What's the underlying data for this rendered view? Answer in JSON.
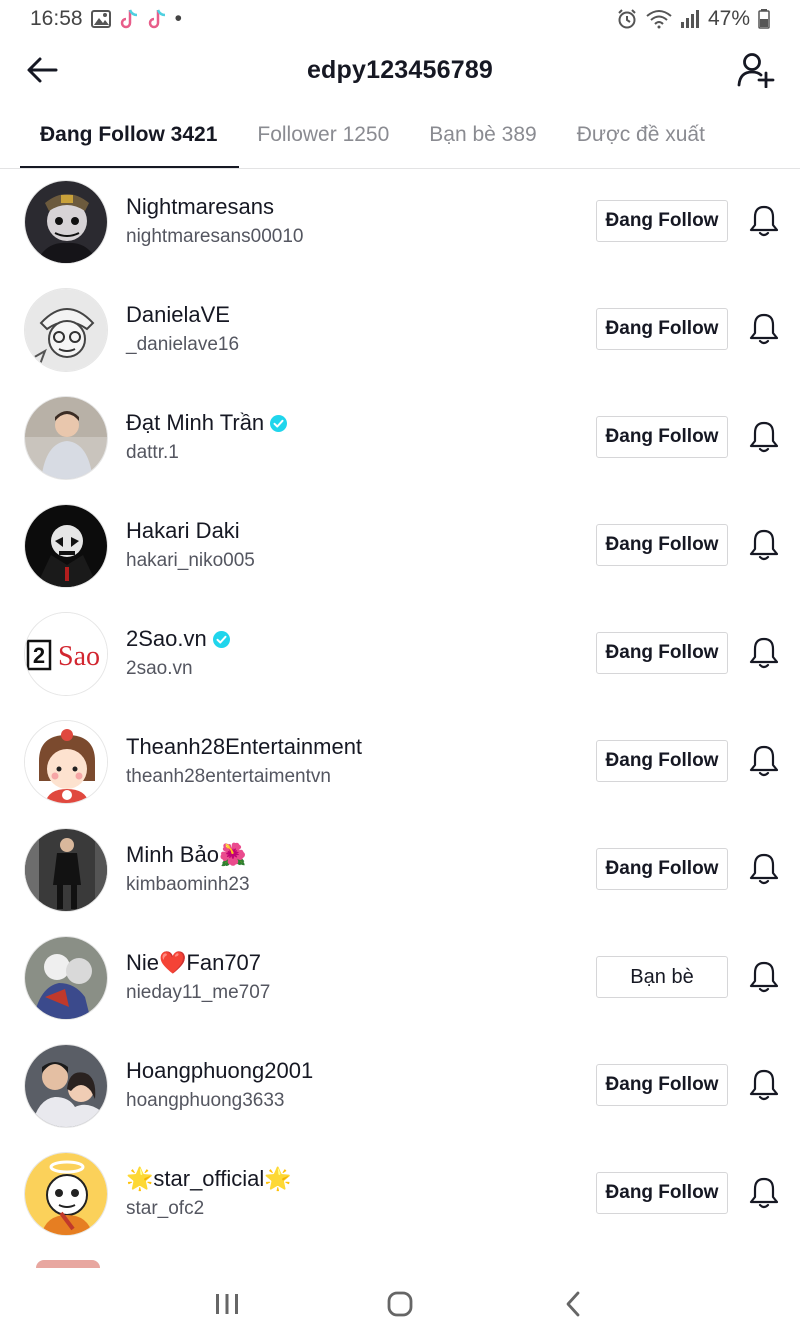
{
  "status_bar": {
    "time": "16:58",
    "dot": "•",
    "battery": "47%"
  },
  "header": {
    "title": "edpy123456789"
  },
  "tabs": [
    {
      "label": "Đang Follow 3421",
      "active": true
    },
    {
      "label": "Follower 1250",
      "active": false
    },
    {
      "label": "Bạn bè 389",
      "active": false
    },
    {
      "label": "Được đề xuất",
      "active": false
    }
  ],
  "users": [
    {
      "name": "Nightmaresans",
      "username": "nightmaresans00010",
      "button": "Đang Follow",
      "verified": false
    },
    {
      "name": "DanielaVE",
      "username": "_danielave16",
      "button": "Đang Follow",
      "verified": false
    },
    {
      "name": "Đạt Minh Trần",
      "username": "dattr.1",
      "button": "Đang Follow",
      "verified": true
    },
    {
      "name": "Hakari Daki",
      "username": "hakari_niko005",
      "button": "Đang Follow",
      "verified": false
    },
    {
      "name": "2Sao.vn",
      "username": "2sao.vn",
      "button": "Đang Follow",
      "verified": true
    },
    {
      "name": "Theanh28Entertainment",
      "username": "theanh28entertaimentvn",
      "button": "Đang Follow",
      "verified": false
    },
    {
      "name": "Minh Bảo🌺",
      "username": "kimbaominh23",
      "button": "Đang Follow",
      "verified": false
    },
    {
      "name": "Nie❤️Fan707",
      "username": "nieday11_me707",
      "button": "Bạn bè",
      "verified": false
    },
    {
      "name": "Hoangphuong2001",
      "username": "hoangphuong3633",
      "button": "Đang Follow",
      "verified": false
    },
    {
      "name": "🌟star_official🌟",
      "username": "star_ofc2",
      "button": "Đang Follow",
      "verified": false
    }
  ],
  "avatar_logo_text": {
    "num": "2",
    "word": "Sao"
  },
  "colors": {
    "verified": "#20d5ec",
    "text_primary": "#161823",
    "text_secondary": "#545660",
    "tab_inactive": "#8a8b91"
  },
  "icons": {
    "back": "arrow-left-icon",
    "add_user": "add-user-icon",
    "bell": "bell-icon",
    "verified": "verified-check-icon"
  }
}
